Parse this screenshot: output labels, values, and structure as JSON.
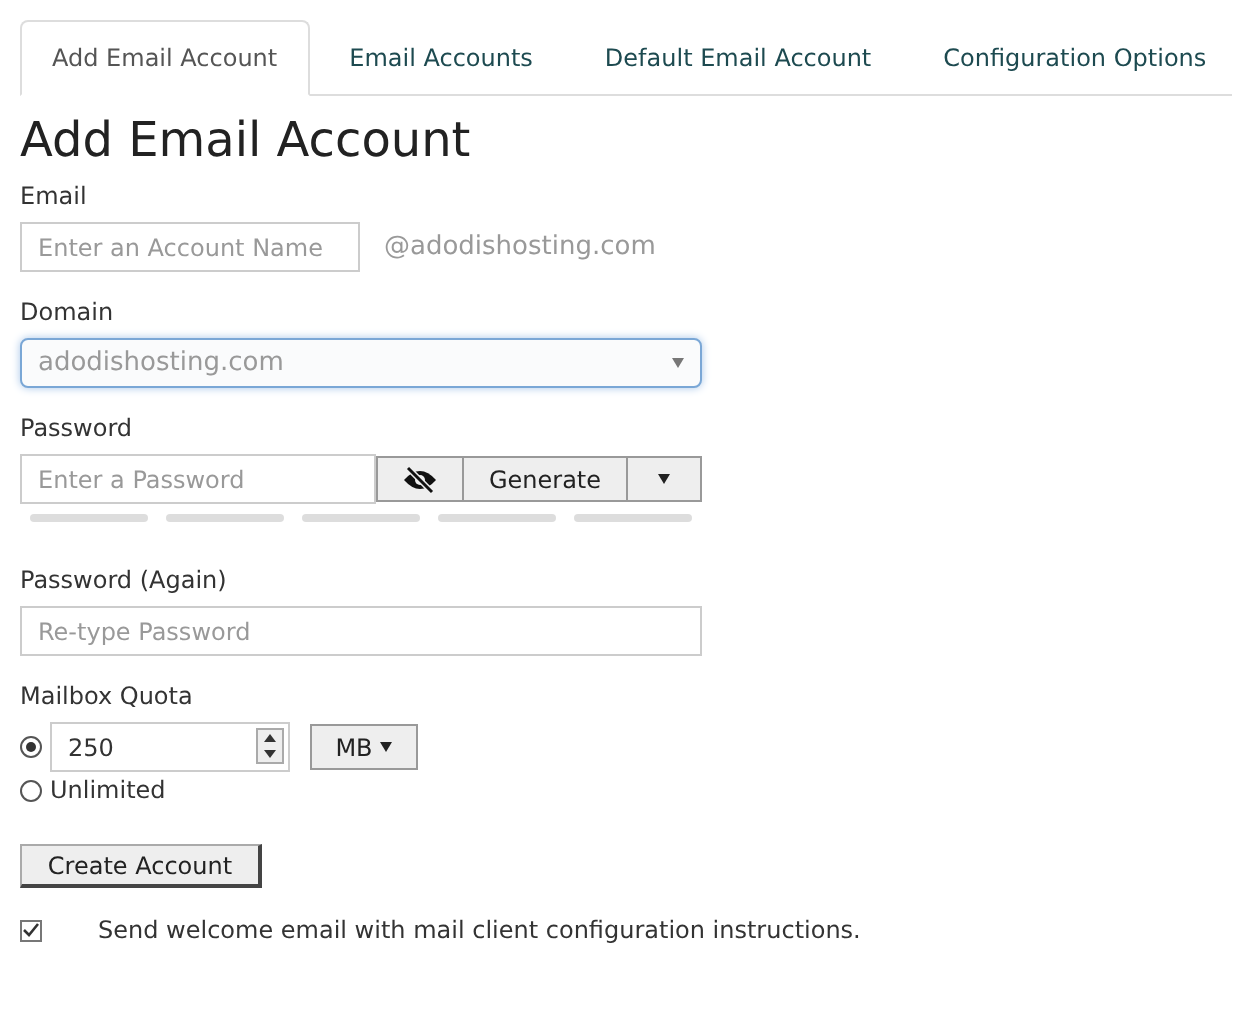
{
  "tabs": [
    {
      "label": "Add Email Account",
      "selected": true
    },
    {
      "label": "Email Accounts",
      "selected": false
    },
    {
      "label": "Default Email Account",
      "selected": false
    },
    {
      "label": "Configuration Options",
      "selected": false
    }
  ],
  "heading": "Add Email Account",
  "email": {
    "label": "Email",
    "placeholder": "Enter an Account Name",
    "suffix": "@adodishosting.com"
  },
  "domain": {
    "label": "Domain",
    "value": "adodishosting.com"
  },
  "password": {
    "label": "Password",
    "placeholder": "Enter a Password",
    "generate_button": "Generate"
  },
  "password_again": {
    "label": "Password (Again)",
    "placeholder": "Re-type Password"
  },
  "quota": {
    "label": "Mailbox Quota",
    "options": [
      {
        "kind": "number",
        "value": "250",
        "unit": "MB",
        "selected": true
      },
      {
        "kind": "unlimited",
        "label": "Unlimited",
        "selected": false
      }
    ]
  },
  "create_button": "Create Account",
  "welcome_email": {
    "label": "Send welcome email with mail client configuration instructions.",
    "checked": true
  }
}
